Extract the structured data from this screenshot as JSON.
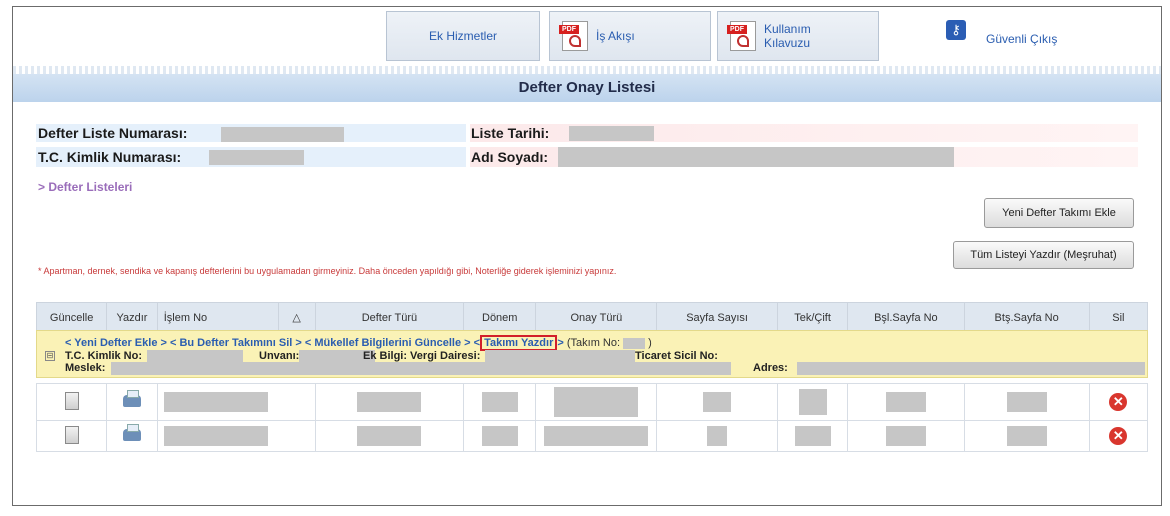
{
  "topnav": {
    "ek_hizmetler": "Ek Hizmetler",
    "is_akisi": "İş Akışı",
    "kullanim_line1": "Kullanım",
    "kullanim_line2": "Kılavuzu",
    "guvenli_cikis": "Güvenli Çıkış",
    "pdf_tag": "PDF"
  },
  "title": "Defter Onay Listesi",
  "info": {
    "defter_liste_no": "Defter Liste Numarası:",
    "liste_tarihi": "Liste Tarihi:",
    "tc_kimlik": "T.C. Kimlik Numarası:",
    "adi_soyadi": "Adı Soyadı:"
  },
  "link_defter_listeleri": "> Defter Listeleri",
  "buttons": {
    "yeni_defter": "Yeni Defter Takımı Ekle",
    "tum_listeyi": "Tüm Listeyi Yazdır (Meşruhat)"
  },
  "note": "* Apartman, dernek, sendika ve kapanış defterlerini bu uygulamadan girmeyiniz. Daha önceden yapıldığı gibi, Noterliğe giderek işleminizi yapınız.",
  "table": {
    "headers": [
      "Güncelle",
      "Yazdır",
      "İşlem No",
      "△",
      "Defter Türü",
      "Dönem",
      "Onay Türü",
      "Sayfa Sayısı",
      "Tek/Çift",
      "Bşl.Sayfa No",
      "Btş.Sayfa No",
      "Sil"
    ]
  },
  "group": {
    "yeni_defter_ekle": "< Yeni Defter Ekle >",
    "bu_defter_sil": "< Bu Defter Takımını Sil >",
    "mukellef_guncelle": "< Mükellef Bilgilerini Güncelle >",
    "lt": "<",
    "takimi_yazdir": "Takımı Yazdır",
    "gt": ">",
    "takim_no": "(Takım No:",
    "close_paren": ")",
    "tc_kimlik_no": "T.C. Kimlik No:",
    "unvani": "Unvanı:",
    "ek_bilgi": "Ek Bilgi: Vergi Dairesi:",
    "ticaret_sicil": "Ticaret Sicil No:",
    "meslek": "Meslek:",
    "adres": "Adres:",
    "expander": "⊟"
  },
  "icons": {
    "delete": "✕",
    "key": "🔑"
  },
  "colors": {
    "link": "#2a5db0",
    "highlight_border": "#d21f2a",
    "group_bg": "#faf2b6",
    "title_bar": "#bcd3ec"
  }
}
